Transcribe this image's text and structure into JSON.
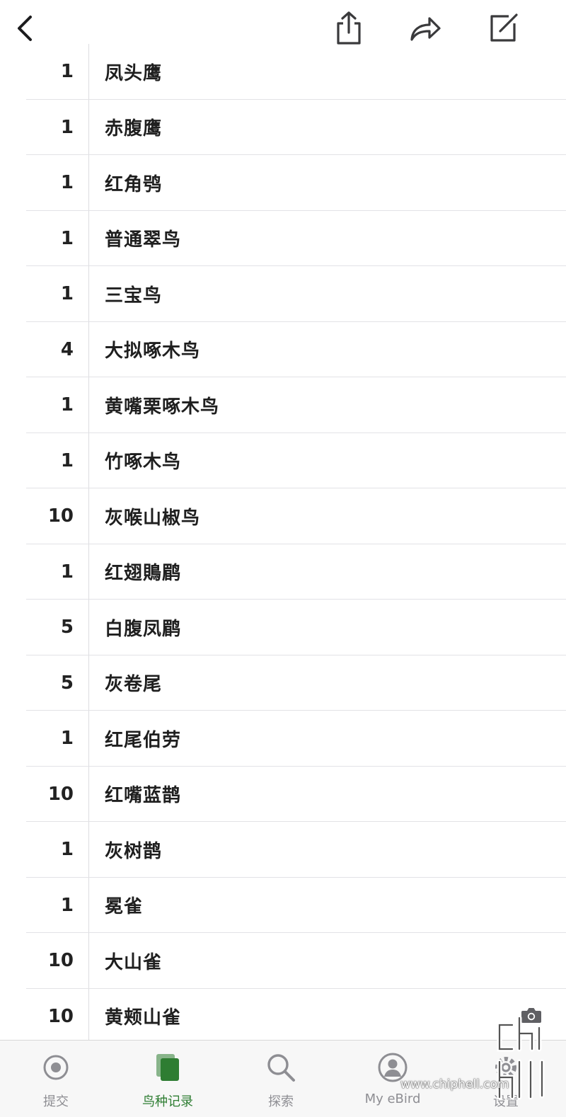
{
  "toolbar": {
    "back_icon": "chevron-left-icon",
    "share_icon": "share-icon",
    "forward_icon": "forward-arrow-icon",
    "edit_icon": "compose-icon"
  },
  "species_list": [
    {
      "count": "1",
      "name": "凤头鹰"
    },
    {
      "count": "1",
      "name": "赤腹鹰"
    },
    {
      "count": "1",
      "name": "红角鸮"
    },
    {
      "count": "1",
      "name": "普通翠鸟"
    },
    {
      "count": "1",
      "name": "三宝鸟"
    },
    {
      "count": "4",
      "name": "大拟啄木鸟"
    },
    {
      "count": "1",
      "name": "黄嘴栗啄木鸟"
    },
    {
      "count": "1",
      "name": "竹啄木鸟"
    },
    {
      "count": "10",
      "name": "灰喉山椒鸟"
    },
    {
      "count": "1",
      "name": "红翅鵙鹛"
    },
    {
      "count": "5",
      "name": "白腹凤鹛"
    },
    {
      "count": "5",
      "name": "灰卷尾"
    },
    {
      "count": "1",
      "name": "红尾伯劳"
    },
    {
      "count": "10",
      "name": "红嘴蓝鹊"
    },
    {
      "count": "1",
      "name": "灰树鹊"
    },
    {
      "count": "1",
      "name": "冕雀"
    },
    {
      "count": "10",
      "name": "大山雀"
    },
    {
      "count": "10",
      "name": "黄颊山雀",
      "has_photo": true
    }
  ],
  "tabbar": {
    "tabs": [
      {
        "label": "提交",
        "icon": "target-icon"
      },
      {
        "label": "鸟种记录",
        "icon": "checklists-icon",
        "active": true
      },
      {
        "label": "探索",
        "icon": "search-icon"
      },
      {
        "label": "My eBird",
        "icon": "person-icon"
      },
      {
        "label": "设置",
        "icon": "gear-icon"
      }
    ]
  },
  "watermark": {
    "url": "www.chiphell.com",
    "logo": "chip hell"
  },
  "colors": {
    "accent": "#2e7d32",
    "inactive": "#8e8e93",
    "divider": "#e2e2e6"
  }
}
